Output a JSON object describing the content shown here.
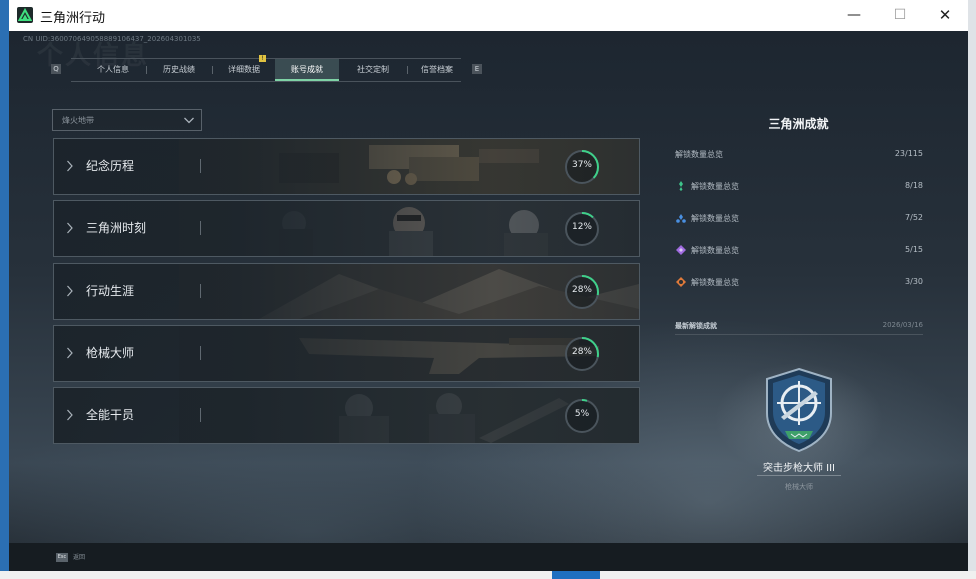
{
  "window": {
    "title": "三角洲行动",
    "controls": {
      "minimize": "—",
      "maximize": "☐",
      "close": "✕"
    }
  },
  "header": {
    "uid": "CN UID:360070649058889106437_202604301035",
    "bg_title": "个人信息"
  },
  "tabs": [
    {
      "label": "个人信息",
      "active": false
    },
    {
      "label": "历史战绩",
      "active": false
    },
    {
      "label": "详细数据",
      "active": false
    },
    {
      "label": "账号成就",
      "active": true
    },
    {
      "label": "社交定制",
      "active": false
    },
    {
      "label": "信誉档案",
      "active": false
    }
  ],
  "nav_keys": {
    "left": "Q",
    "right": "E"
  },
  "notification_badge": "!",
  "filter": {
    "value": "烽火地带"
  },
  "categories": [
    {
      "name": "纪念历程",
      "progress": 0.37,
      "progress_text": "37%"
    },
    {
      "name": "三角洲时刻",
      "progress": 0.12,
      "progress_text": "12%"
    },
    {
      "name": "行动生涯",
      "progress": 0.28,
      "progress_text": "28%"
    },
    {
      "name": "枪械大师",
      "progress": 0.28,
      "progress_text": "28%"
    },
    {
      "name": "全能干员",
      "progress": 0.05,
      "progress_text": "5%"
    }
  ],
  "summary": {
    "title": "三角洲成就",
    "total_label": "解锁数量总览",
    "total_value": "23/115",
    "items": [
      {
        "label": "解锁数量总览",
        "value": "8/18",
        "icon": "green-medal-icon",
        "color": "#3ec48a"
      },
      {
        "label": "解锁数量总览",
        "value": "7/52",
        "icon": "blue-medal-icon",
        "color": "#4a90e2"
      },
      {
        "label": "解锁数量总览",
        "value": "5/15",
        "icon": "purple-medal-icon",
        "color": "#a06be0"
      },
      {
        "label": "解锁数量总览",
        "value": "3/30",
        "icon": "orange-medal-icon",
        "color": "#e07a3a"
      }
    ]
  },
  "latest": {
    "label": "最新解锁成就",
    "date": "2026/03/16",
    "name": "突击步枪大师 III",
    "category": "枪械大师"
  },
  "bottom": {
    "esc_key": "Esc",
    "esc_label": "返回"
  }
}
